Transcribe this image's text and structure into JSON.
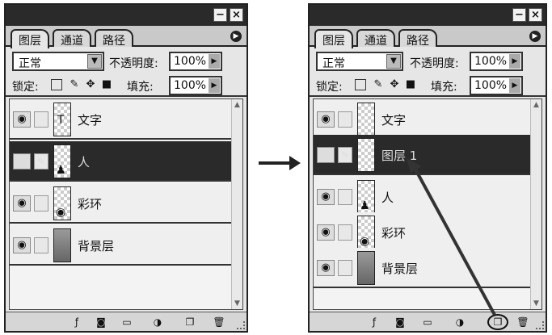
{
  "window": {
    "minimize_icon": "minimize-icon",
    "close_icon": "close-icon"
  },
  "tabs": [
    "图层",
    "通道",
    "路径"
  ],
  "blend_mode": "正常",
  "opacity_label": "不透明度:",
  "opacity_value": "100%",
  "lock_label": "锁定:",
  "lock_icons": [
    "lock-transparent-icon",
    "lock-paint-icon",
    "lock-move-icon",
    "lock-all-icon"
  ],
  "fill_label": "填充:",
  "fill_value": "100%",
  "before": {
    "layers": [
      {
        "name": "文字",
        "selected": false,
        "linked": false
      },
      {
        "name": "人",
        "selected": true,
        "linked": true
      },
      {
        "name": "彩环",
        "selected": false,
        "linked": false
      },
      {
        "name": "背景层",
        "selected": false,
        "linked": false
      }
    ]
  },
  "after": {
    "layers": [
      {
        "name": "文字",
        "selected": false,
        "linked": false
      },
      {
        "name": "图层 1",
        "selected": true,
        "linked": true
      },
      {
        "name": "人",
        "selected": false,
        "linked": false
      },
      {
        "name": "彩环",
        "selected": false,
        "linked": false
      },
      {
        "name": "背景层",
        "selected": false,
        "linked": false
      }
    ]
  },
  "footer_icons": [
    "layer-style-icon",
    "layer-mask-icon",
    "new-group-icon",
    "adjustment-layer-icon",
    "new-layer-icon",
    "trash-icon"
  ],
  "highlighted_button": "new-layer-icon"
}
